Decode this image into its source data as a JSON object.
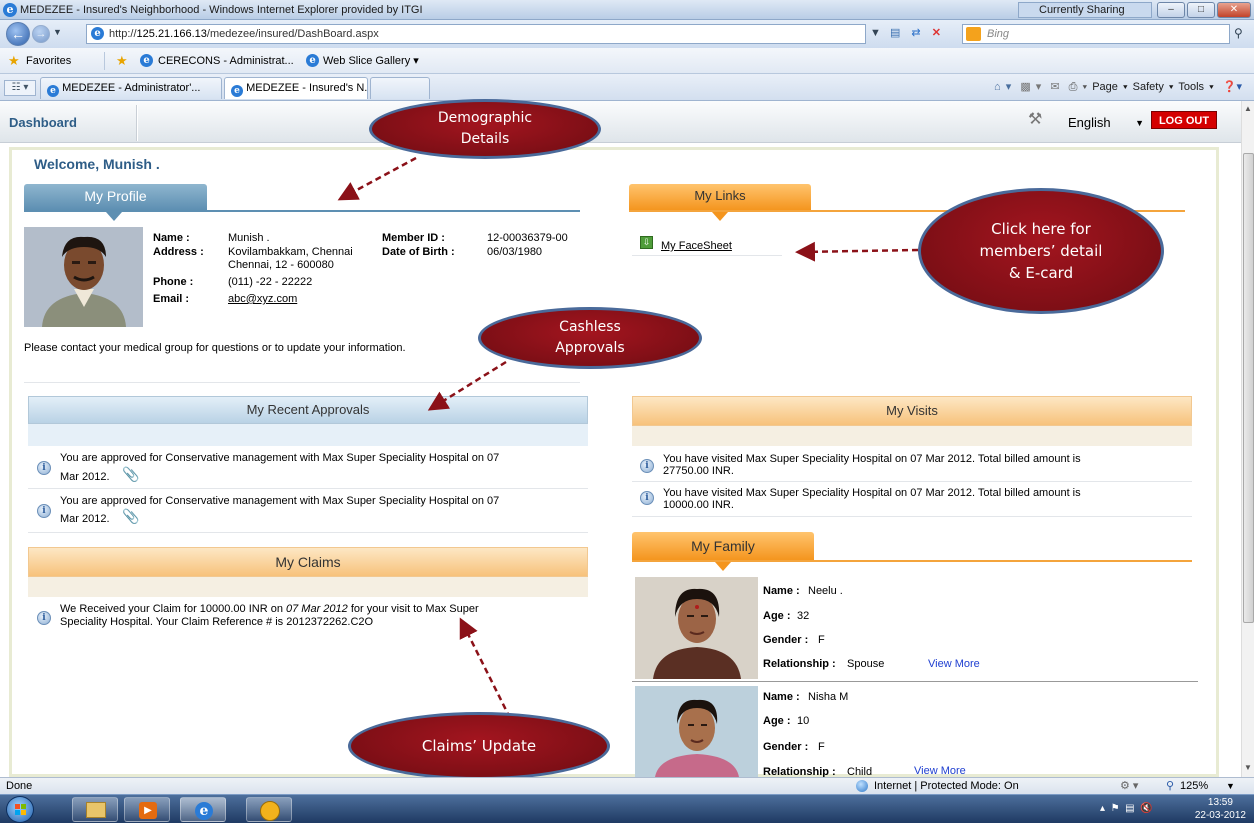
{
  "window": {
    "title": "MEDEZEE - Insured's Neighborhood - Windows Internet Explorer provided by ITGI",
    "sharing": "Currently Sharing"
  },
  "address_bar": {
    "url_prefix": "http://",
    "url_host": "125.21.166.13",
    "url_path": "/medezee/insured/DashBoard.aspx",
    "search_placeholder": "Bing"
  },
  "favorites": {
    "label": "Favorites",
    "items": [
      "CERECONS - Administrat...",
      "Web Slice Gallery ▾"
    ]
  },
  "tabs": [
    {
      "label": "MEDEZEE - Administrator'..."
    },
    {
      "label": "MEDEZEE - Insured's N...",
      "close": "×"
    }
  ],
  "command_bar": "Page ▾   Safety ▾   Tools ▾",
  "app": {
    "nav_dashboard": "Dashboard",
    "language": "English",
    "logout": "LOG OUT",
    "welcome": "Welcome, Munish ."
  },
  "profile": {
    "header": "My Profile",
    "name_label": "Name :",
    "name": "Munish .",
    "address_label": "Address :",
    "address_line1": "Kovilambakkam, Chennai",
    "address_line2": "Chennai, 12 - 600080",
    "phone_label": "Phone :",
    "phone": "(011) -22 - 22222",
    "email_label": "Email :",
    "email": "abc@xyz.com",
    "member_id_label": "Member ID :",
    "member_id": "12-00036379-00",
    "dob_label": "Date of Birth :",
    "dob": "06/03/1980",
    "note": "Please contact your medical group for questions or to update your information."
  },
  "links": {
    "header": "My Links",
    "facesheet": "My FaceSheet"
  },
  "approvals": {
    "header": "My Recent Approvals",
    "items": [
      {
        "line1": "You are approved for Conservative management with Max Super Speciality Hospital on 07",
        "line2": "Mar 2012."
      },
      {
        "line1": "You are approved for Conservative management with Max Super Speciality Hospital on 07",
        "line2": "Mar 2012."
      }
    ]
  },
  "visits": {
    "header": "My Visits",
    "items": [
      {
        "line1": "You have visited Max Super Speciality Hospital on 07 Mar 2012. Total billed amount is",
        "line2": "27750.00 INR."
      },
      {
        "line1": "You have visited Max Super Speciality Hospital on 07 Mar 2012. Total billed amount is",
        "line2": "10000.00 INR."
      }
    ]
  },
  "claims": {
    "header": "My Claims",
    "line1_a": "We Received your Claim for 10000.00 INR on ",
    "line1_date": "07 Mar 2012",
    "line1_b": " for your visit to Max Super",
    "line2": "Speciality Hospital. Your Claim Reference # is 2012372262.C2O"
  },
  "family": {
    "header": "My Family",
    "name_label": "Name :",
    "age_label": "Age :",
    "gender_label": "Gender :",
    "relationship_label": "Relationship :",
    "view_more": "View More",
    "members": [
      {
        "name": "Neelu .",
        "age": "32",
        "gender": "F",
        "relationship": "Spouse"
      },
      {
        "name": "Nisha M",
        "age": "10",
        "gender": "F",
        "relationship": "Child"
      }
    ]
  },
  "callouts": {
    "demographic": [
      "Demographic",
      "Details"
    ],
    "cashless": [
      "Cashless",
      "Approvals"
    ],
    "members": [
      "Click here for",
      "members’ detail",
      "& E-card"
    ],
    "claims": [
      "Claims’ Update"
    ]
  },
  "status": {
    "left": "Done",
    "zone": "Internet | Protected Mode: On",
    "zoom": "125%"
  },
  "taskbar": {
    "time": "13:59",
    "date": "22-03-2012"
  },
  "colors": {
    "callout_fill": "#8b1118",
    "callout_border": "#4a6a9a",
    "profile_header": "#5d8fb2",
    "orange_header": "#f4951e",
    "logout": "#d40000"
  }
}
